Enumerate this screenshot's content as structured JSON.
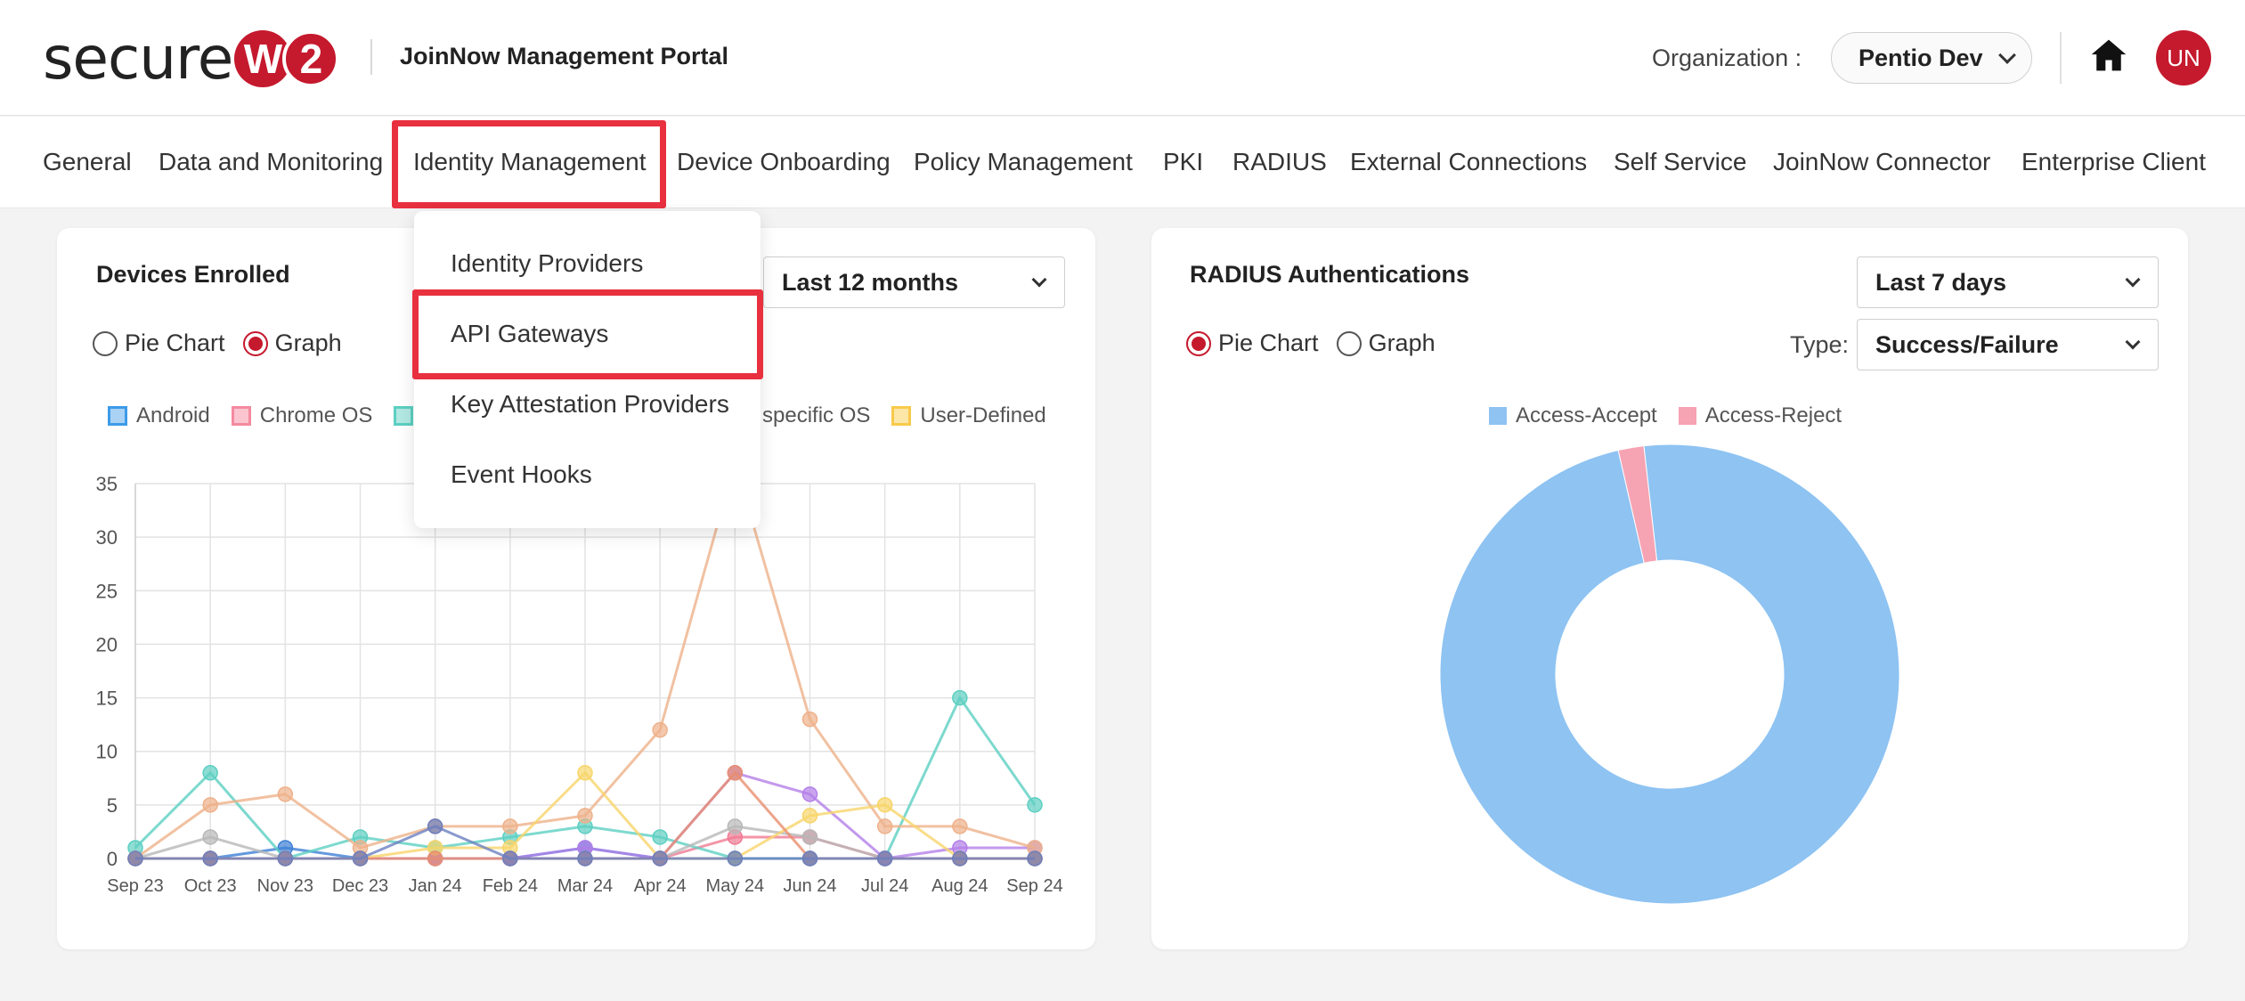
{
  "header": {
    "logo_text": "secure",
    "logo_w": "W",
    "logo_2": "2",
    "portal_title": "JoinNow Management Portal",
    "org_label": "Organization :",
    "org_value": "Pentio Dev",
    "home_icon": "home-icon",
    "avatar_initials": "UN"
  },
  "nav": {
    "items": [
      "General",
      "Data and Monitoring",
      "Identity Management",
      "Device Onboarding",
      "Policy Management",
      "PKI",
      "RADIUS",
      "External Connections",
      "Self Service",
      "JoinNow Connector",
      "Enterprise Client"
    ],
    "active": "Identity Management"
  },
  "dropdown": {
    "items": [
      "Identity Providers",
      "API Gateways",
      "Key Attestation Providers",
      "Event Hooks"
    ],
    "highlighted": "API Gateways"
  },
  "devices_card": {
    "title": "Devices Enrolled",
    "range": "Last 12 months",
    "radio_pie": "Pie Chart",
    "radio_graph": "Graph",
    "selected": "Graph",
    "legend_visible": [
      {
        "label": "Android",
        "color": "#3d9be9"
      },
      {
        "label": "Chrome OS",
        "color": "#f48aa0"
      },
      {
        "label": "specific OS",
        "color": "#f0a868"
      },
      {
        "label": "User-Defined",
        "color": "#f8c94a"
      }
    ]
  },
  "radius_card": {
    "title": "RADIUS Authentications",
    "range": "Last 7 days",
    "radio_pie": "Pie Chart",
    "radio_graph": "Graph",
    "selected": "Pie Chart",
    "type_label": "Type:",
    "type_value": "Success/Failure",
    "legend": [
      {
        "label": "Access-Accept",
        "color": "#8ec3f2"
      },
      {
        "label": "Access-Reject",
        "color": "#f6a3b3"
      }
    ]
  },
  "chart_data": [
    {
      "type": "line",
      "title": "Devices Enrolled",
      "x": [
        "Sep 23",
        "Oct 23",
        "Nov 23",
        "Dec 23",
        "Jan 24",
        "Feb 24",
        "Mar 24",
        "Apr 24",
        "May 24",
        "Jun 24",
        "Jul 24",
        "Aug 24",
        "Sep 24"
      ],
      "ylim": [
        0,
        35
      ],
      "yticks": [
        0,
        5,
        10,
        15,
        20,
        25,
        30,
        35
      ],
      "grid": true,
      "series": [
        {
          "name": "Android",
          "color": "#3d7fd6",
          "values": [
            0,
            0,
            1,
            0,
            0,
            0,
            1,
            0,
            0,
            0,
            0,
            0,
            0
          ]
        },
        {
          "name": "Chrome OS",
          "color": "#f07a93",
          "values": [
            0,
            0,
            0,
            0,
            0,
            0,
            0,
            0,
            2,
            2,
            0,
            0,
            0
          ]
        },
        {
          "color": "#5ccfc2",
          "values": [
            1,
            8,
            0,
            2,
            1,
            2,
            3,
            2,
            0,
            0,
            0,
            15,
            5
          ]
        },
        {
          "color": "#b8b8b8",
          "values": [
            0,
            2,
            0,
            0,
            0,
            0,
            0,
            0,
            3,
            2,
            0,
            0,
            0
          ]
        },
        {
          "color": "#b47fe8",
          "values": [
            0,
            0,
            0,
            0,
            0,
            0,
            1,
            0,
            8,
            6,
            0,
            1,
            1
          ]
        },
        {
          "name": "specific OS",
          "color": "#eeb18a",
          "values": [
            0,
            5,
            6,
            1,
            3,
            3,
            4,
            12,
            37,
            13,
            3,
            3,
            1
          ]
        },
        {
          "name": "User-Defined",
          "color": "#f8d56a",
          "values": [
            0,
            0,
            0,
            0,
            1,
            1,
            8,
            0,
            0,
            4,
            5,
            0,
            0
          ]
        },
        {
          "color": "#e88f6e",
          "values": [
            0,
            0,
            0,
            0,
            0,
            0,
            0,
            0,
            8,
            0,
            0,
            0,
            0
          ]
        },
        {
          "color": "#6b7fbf",
          "values": [
            0,
            0,
            0,
            0,
            3,
            0,
            0,
            0,
            0,
            0,
            0,
            0,
            0
          ]
        }
      ]
    },
    {
      "type": "pie",
      "title": "RADIUS Authentications",
      "donut": true,
      "categories": [
        "Access-Accept",
        "Access-Reject"
      ],
      "values": [
        98.2,
        1.8
      ],
      "colors": [
        "#8ec3f2",
        "#f6a3b3"
      ]
    }
  ]
}
